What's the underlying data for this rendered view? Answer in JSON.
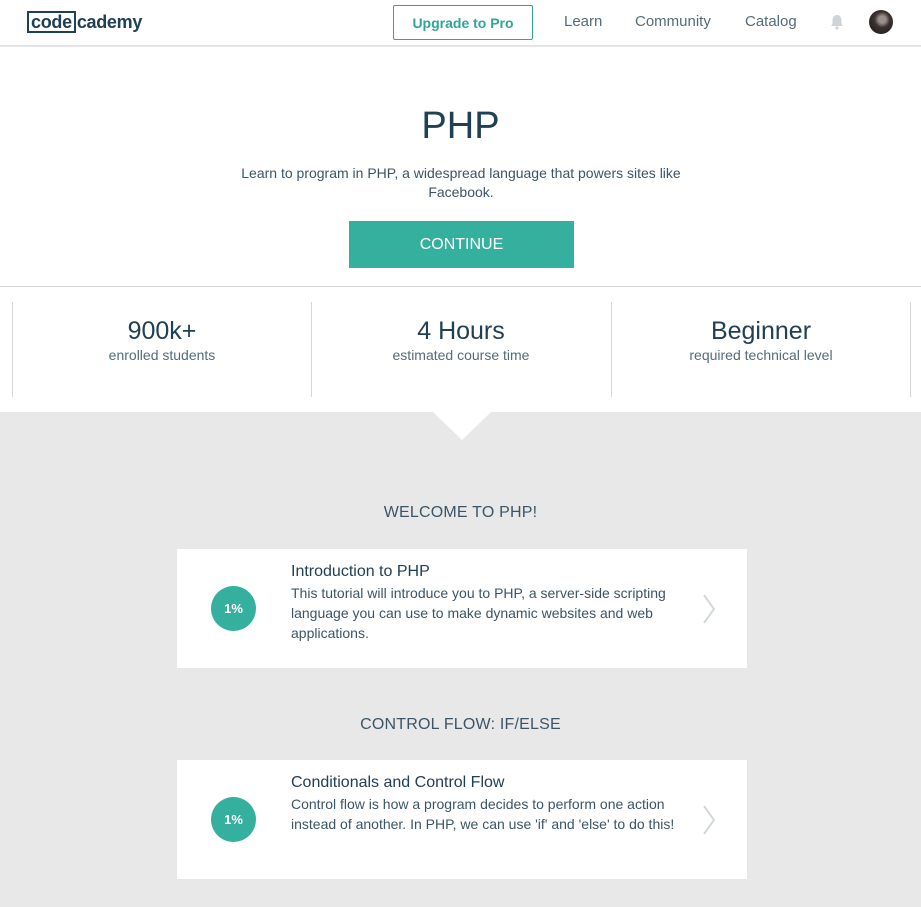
{
  "header": {
    "logo_part1": "code",
    "logo_part2": "cademy",
    "upgrade_label": "Upgrade to Pro",
    "nav": [
      "Learn",
      "Community",
      "Catalog"
    ]
  },
  "hero": {
    "title": "PHP",
    "description": "Learn to program in PHP, a widespread language that powers sites like Facebook.",
    "continue_label": "CONTINUE"
  },
  "stats": [
    {
      "value": "900k+",
      "label": "enrolled students"
    },
    {
      "value": "4 Hours",
      "label": "estimated course time"
    },
    {
      "value": "Beginner",
      "label": "required technical level"
    }
  ],
  "sections": [
    {
      "title": "WELCOME TO PHP!",
      "lesson": {
        "progress": "1%",
        "title": "Introduction to PHP",
        "description": "This tutorial will introduce you to PHP, a server-side scripting language you can use to make dynamic websites and web applications."
      }
    },
    {
      "title": "CONTROL FLOW: IF/ELSE",
      "lesson": {
        "progress": "1%",
        "title": "Conditionals and Control Flow",
        "description": "Control flow is how a program decides to perform one action instead of another. In PHP, we can use 'if' and 'else' to do this!"
      }
    }
  ],
  "colors": {
    "accent": "#35b09f",
    "text_dark": "#204056",
    "background": "#e8e8e8"
  },
  "icons": [
    "bell-icon",
    "chevron-right-icon"
  ]
}
